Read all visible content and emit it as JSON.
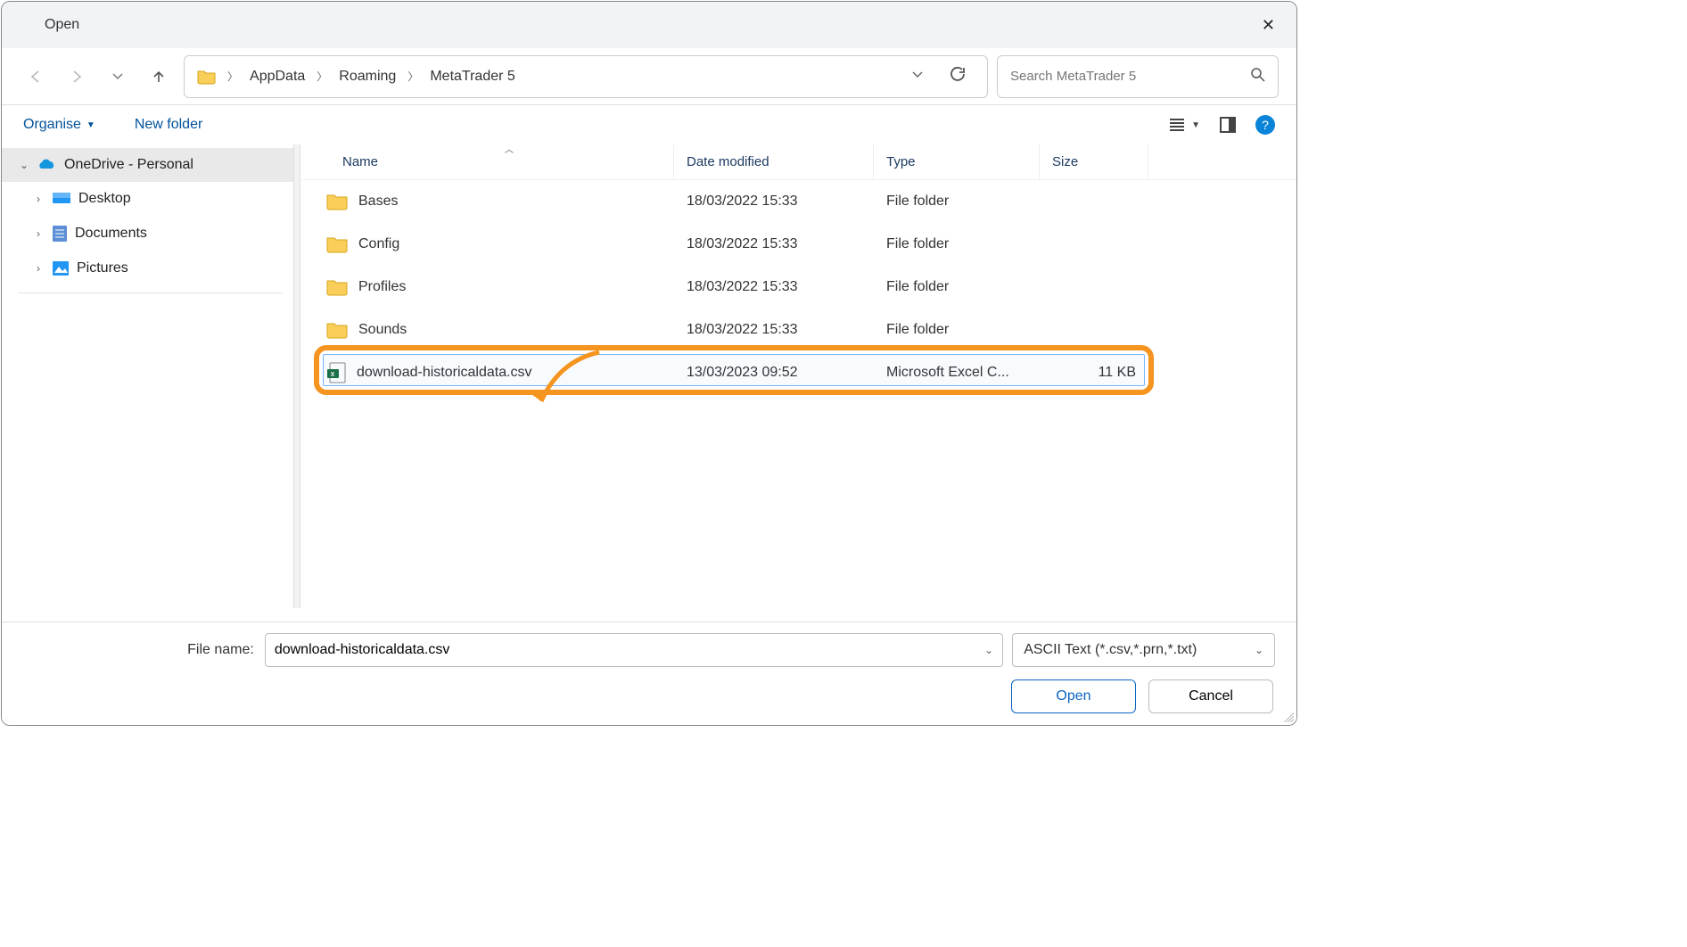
{
  "window": {
    "title": "Open"
  },
  "nav": {
    "back": "←",
    "forward": "→",
    "recent": "˅",
    "up": "↑"
  },
  "breadcrumb": {
    "parts": [
      "AppData",
      "Roaming",
      "MetaTrader 5"
    ]
  },
  "search": {
    "placeholder": "Search MetaTrader 5"
  },
  "toolbar": {
    "organise": "Organise",
    "newfolder": "New folder"
  },
  "sidebar": {
    "root": "OneDrive - Personal",
    "children": [
      "Desktop",
      "Documents",
      "Pictures"
    ]
  },
  "columns": {
    "name": "Name",
    "date": "Date modified",
    "type": "Type",
    "size": "Size"
  },
  "rows": [
    {
      "name": "Bases",
      "date": "18/03/2022 15:33",
      "type": "File folder",
      "size": "",
      "kind": "folder"
    },
    {
      "name": "Config",
      "date": "18/03/2022 15:33",
      "type": "File folder",
      "size": "",
      "kind": "folder"
    },
    {
      "name": "Profiles",
      "date": "18/03/2022 15:33",
      "type": "File folder",
      "size": "",
      "kind": "folder"
    },
    {
      "name": "Sounds",
      "date": "18/03/2022 15:33",
      "type": "File folder",
      "size": "",
      "kind": "folder"
    },
    {
      "name": "download-historicaldata.csv",
      "date": "13/03/2023 09:52",
      "type": "Microsoft Excel C...",
      "size": "11 KB",
      "kind": "csv"
    }
  ],
  "footer": {
    "fname_label": "File name:",
    "fname_value": "download-historicaldata.csv",
    "filter": "ASCII Text (*.csv,*.prn,*.txt)",
    "open": "Open",
    "cancel": "Cancel"
  }
}
